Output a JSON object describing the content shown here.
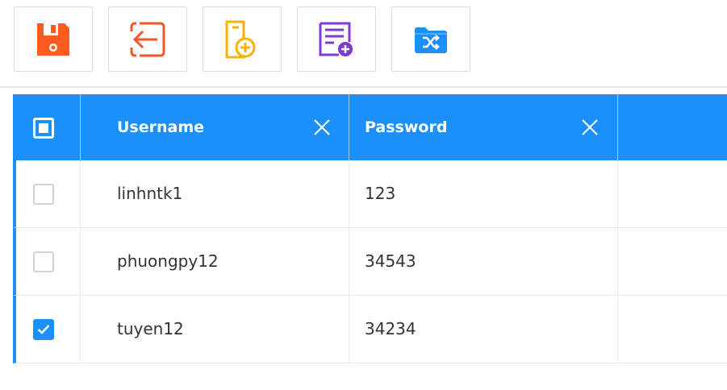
{
  "toolbar": {
    "buttons": [
      {
        "icon": "save-icon",
        "color": "#ff5a1f"
      },
      {
        "icon": "exit-icon",
        "color": "#f0562a"
      },
      {
        "icon": "add-file-icon",
        "color": "#f5b301"
      },
      {
        "icon": "add-form-icon",
        "color": "#7d3bd1"
      },
      {
        "icon": "shuffle-folder-icon",
        "color": "#1b90fb"
      }
    ]
  },
  "table": {
    "header_color": "#1b90fb",
    "columns": [
      {
        "label": "Username"
      },
      {
        "label": "Password"
      }
    ],
    "rows": [
      {
        "username": "linhntk1",
        "password": "123",
        "checked": false
      },
      {
        "username": "phuongpy12",
        "password": "34543",
        "checked": false
      },
      {
        "username": "tuyen12",
        "password": "34234",
        "checked": true
      }
    ]
  }
}
